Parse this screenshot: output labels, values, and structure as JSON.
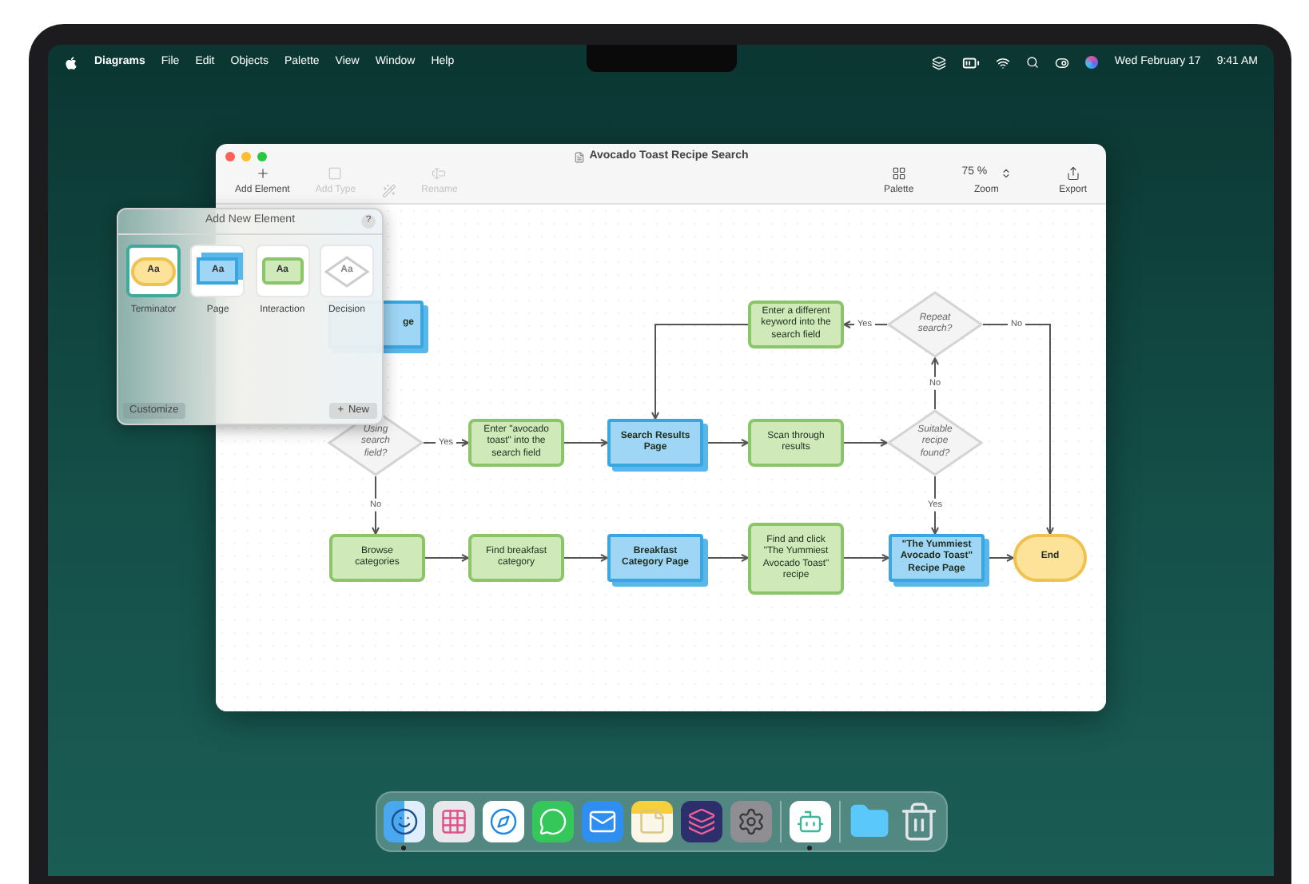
{
  "menu_bar": {
    "app_name": "Diagrams",
    "menus": [
      "File",
      "Edit",
      "Objects",
      "Palette",
      "View",
      "Window",
      "Help"
    ],
    "date": "Wed February 17",
    "time": "9:41 AM"
  },
  "window": {
    "title": "Avocado Toast Recipe Search",
    "toolbar_left": [
      {
        "kind": "add",
        "label": "Add Element",
        "disabled": false
      },
      {
        "kind": "type",
        "label": "Add Type",
        "disabled": true
      },
      {
        "kind": "wand",
        "disabled": true
      },
      {
        "kind": "rename",
        "label": "Rename",
        "disabled": true
      }
    ],
    "toolbar_right": [
      {
        "kind": "palette",
        "label": "Palette"
      },
      {
        "kind": "zoom",
        "label": "Zoom",
        "value": "75 %"
      },
      {
        "kind": "export",
        "label": "Export"
      }
    ]
  },
  "popover": {
    "title": "Add New Element",
    "help": "?",
    "elements": [
      {
        "kind": "terminator",
        "sample": "Aa",
        "label": "Terminator",
        "selected": true
      },
      {
        "kind": "page",
        "sample": "Aa",
        "label": "Page",
        "selected": false
      },
      {
        "kind": "interaction",
        "sample": "Aa",
        "label": "Interaction",
        "selected": false
      },
      {
        "kind": "decision",
        "sample": "Aa",
        "label": "Decision",
        "selected": false
      }
    ],
    "customize": "Customize",
    "new": "New",
    "new_icon": "+"
  },
  "diagram": {
    "nodes": [
      {
        "kind": "page",
        "text": "ge"
      },
      {
        "kind": "decision",
        "text": "Using search field?"
      },
      {
        "kind": "interaction",
        "text": "Enter \"avocado toast\" into the search field"
      },
      {
        "kind": "page",
        "text": "Search Results Page"
      },
      {
        "kind": "interaction",
        "text": "Scan through results"
      },
      {
        "kind": "decision",
        "text": "Suitable recipe found?"
      },
      {
        "kind": "interaction",
        "text": "Enter a different keyword into the search field"
      },
      {
        "kind": "decision",
        "text": "Repeat search?"
      },
      {
        "kind": "interaction",
        "text": "Browse categories"
      },
      {
        "kind": "interaction",
        "text": "Find breakfast category"
      },
      {
        "kind": "page",
        "text": "Breakfast Category Page"
      },
      {
        "kind": "interaction",
        "text": "Find and click \"The Yummiest Avocado Toast\" recipe"
      },
      {
        "kind": "page",
        "text": "\"The Yummiest Avocado Toast\" Recipe Page"
      },
      {
        "kind": "terminator",
        "text": "End"
      }
    ],
    "connector_labels": [
      "Yes",
      "No",
      "Yes",
      "No",
      "Yes",
      "No"
    ]
  },
  "dock": [
    {
      "kind": "finder",
      "running": true
    },
    {
      "kind": "launchpad",
      "running": false
    },
    {
      "kind": "safari",
      "running": false
    },
    {
      "kind": "messages",
      "running": false
    },
    {
      "kind": "mail",
      "running": false
    },
    {
      "kind": "notes",
      "running": false
    },
    {
      "kind": "shortcuts",
      "running": false
    },
    {
      "kind": "settings",
      "running": false
    },
    {
      "kind": "separator"
    },
    {
      "kind": "diagrams",
      "running": true
    },
    {
      "kind": "separator"
    },
    {
      "kind": "folder",
      "running": false
    },
    {
      "kind": "trash",
      "running": false
    }
  ]
}
